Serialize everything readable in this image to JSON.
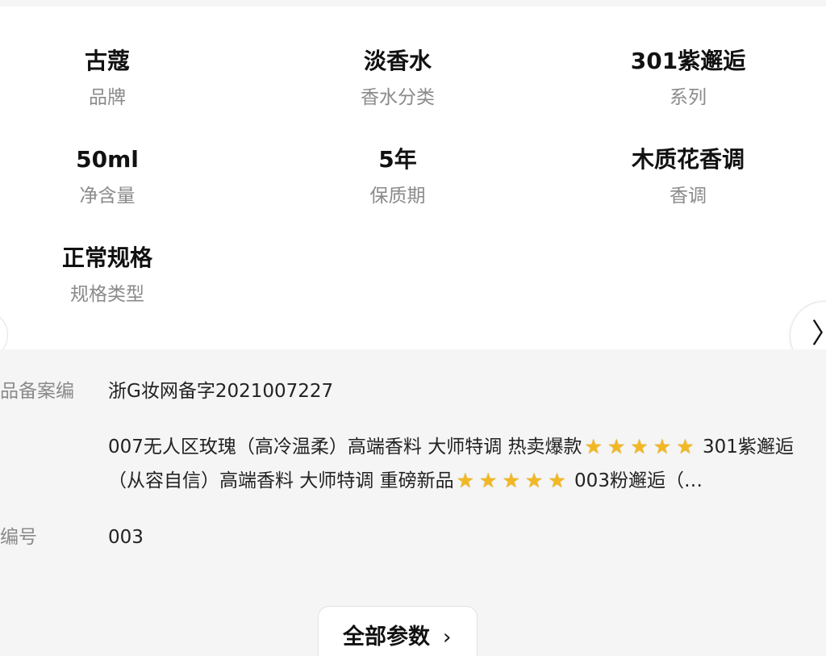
{
  "specs": [
    {
      "value": "古蔻",
      "label": "品牌"
    },
    {
      "value": "淡香水",
      "label": "香水分类"
    },
    {
      "value": "301紫邂逅",
      "label": "系列"
    },
    {
      "value": "50ml",
      "label": "净含量"
    },
    {
      "value": "5年",
      "label": "保质期"
    },
    {
      "value": "木质花香调",
      "label": "香调"
    },
    {
      "value": "正常规格",
      "label": "规格类型"
    }
  ],
  "carousel": {
    "prev_icon": "chevron-left-icon",
    "next_icon": "chevron-right-icon",
    "next_glyph": "〉"
  },
  "details": {
    "filing": {
      "label": "品备案编",
      "value": "浙G妆网备字2021007227"
    },
    "fragrance": {
      "parts": [
        "007无人区玫瑰（高冷温柔）高端香料 大师特调 热卖爆款",
        "301紫邂逅（从容自信）高端香料 大师特调 重磅新品",
        "003粉邂逅（…"
      ],
      "star_glyph": "★",
      "star_color": "#f2b824"
    },
    "number": {
      "label": "编号",
      "value": "003"
    }
  },
  "all_params_button": {
    "label": "全部参数",
    "chevron": "›"
  }
}
